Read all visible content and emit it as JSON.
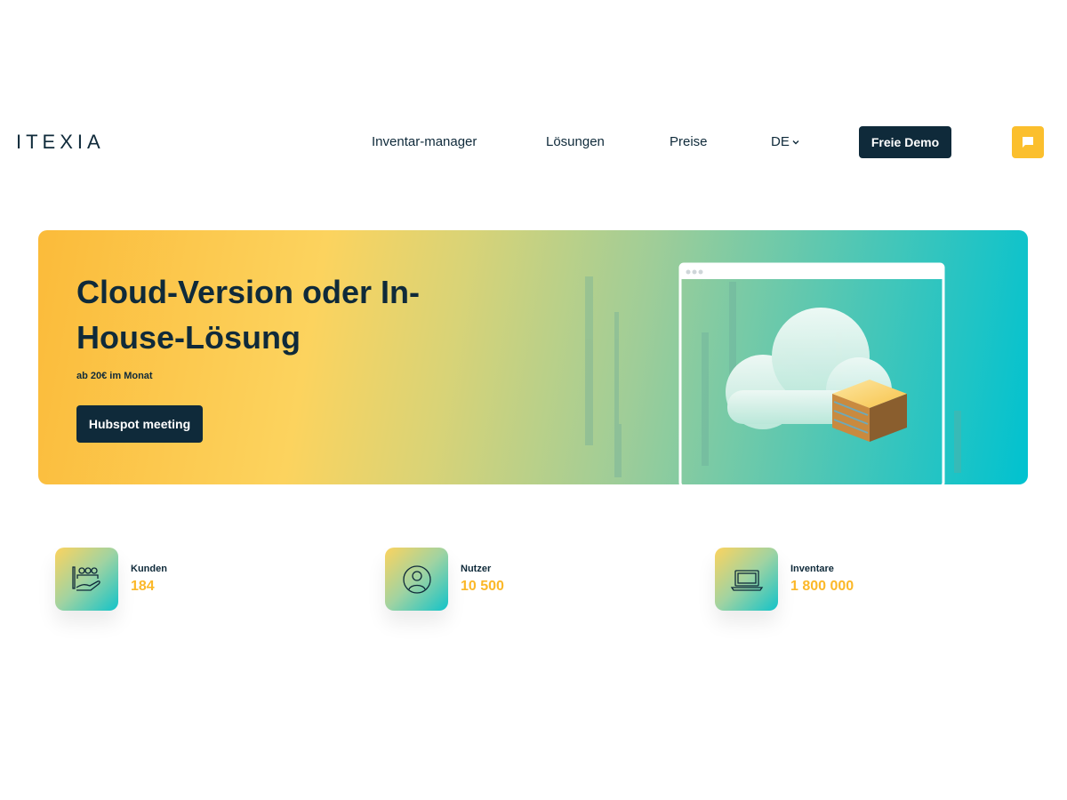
{
  "header": {
    "logo": "ITEXIA",
    "nav": [
      "Inventar-manager",
      "Lösungen",
      "Preise"
    ],
    "language": "DE",
    "demo_button": "Freie Demo",
    "chat_icon": "chat-bubble-icon"
  },
  "hero": {
    "title": "Cloud-Version oder In-House-Lösung",
    "subtitle": "ab 20€ im Monat",
    "button": "Hubspot meeting",
    "illustration": "cloud-server-illustration"
  },
  "stats": [
    {
      "label": "Kunden",
      "value": "184",
      "icon": "customers-hand-icon"
    },
    {
      "label": "Nutzer",
      "value": "10 500",
      "icon": "user-icon"
    },
    {
      "label": "Inventare",
      "value": "1 800 000",
      "icon": "laptop-icon"
    }
  ],
  "colors": {
    "primary_dark": "#0f2a3a",
    "accent_yellow": "#fbb829",
    "accent_teal": "#00c2d0"
  }
}
